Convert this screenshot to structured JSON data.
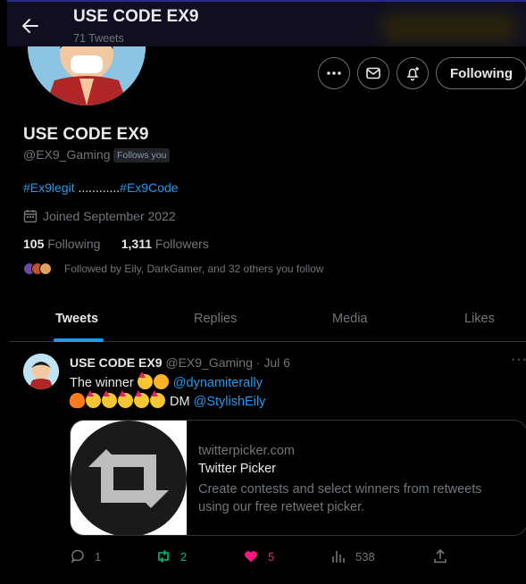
{
  "header": {
    "title": "USE CODE EX9",
    "tweet_count": "71 Tweets"
  },
  "profile": {
    "name": "USE CODE EX9",
    "handle": "@EX9_Gaming",
    "follows_you": "Follows you",
    "bio_tag1": "#Ex9legit",
    "bio_dots": " ............",
    "bio_tag2": "#Ex9Code",
    "joined": "Joined September 2022",
    "following_count": "105",
    "following_label": "Following",
    "followers_count": "1,311",
    "followers_label": "Followers",
    "followed_by": "Followed by Eily, DarkGamer, and 32 others you follow",
    "follow_button": "Following"
  },
  "tabs": [
    "Tweets",
    "Replies",
    "Media",
    "Likes"
  ],
  "tweet": {
    "name": "USE CODE EX9",
    "handle": "@EX9_Gaming",
    "sep": " · ",
    "date": "Jul 6",
    "line1_text": "The winner",
    "mention1": "@dynamiterally",
    "line2_text": "DM",
    "mention2": "@StylishEily",
    "card": {
      "domain": "twitterpicker.com",
      "title": "Twitter Picker",
      "description": "Create contests and select winners from retweets using our free retweet picker."
    },
    "replies": "1",
    "retweets": "2",
    "likes": "5",
    "views": "538"
  },
  "colors": {
    "accent": "#1d9bf0",
    "retweet": "#00ba7c",
    "like": "#f91880"
  }
}
